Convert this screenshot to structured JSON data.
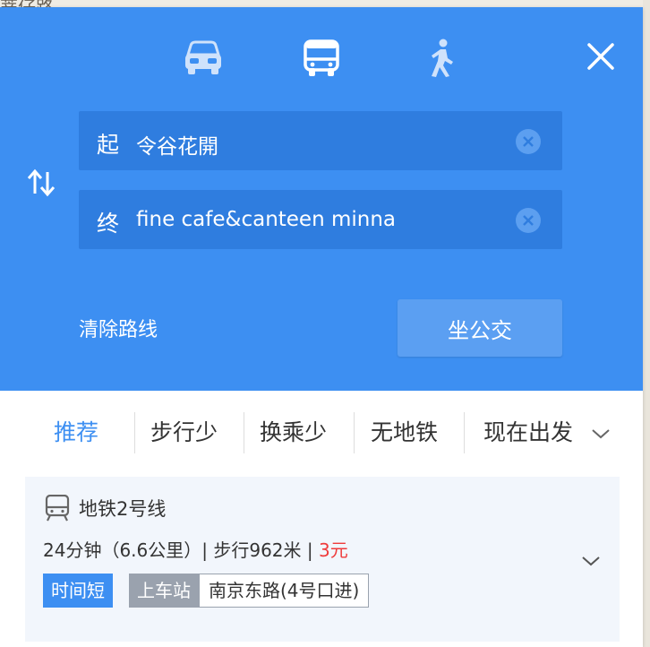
{
  "map": {
    "label": "蒂仔路"
  },
  "transport_modes": [
    {
      "name": "drive",
      "icon": "car-icon",
      "active": false
    },
    {
      "name": "bus",
      "icon": "bus-icon",
      "active": true
    },
    {
      "name": "walk",
      "icon": "walk-icon",
      "active": false
    }
  ],
  "route_input": {
    "start_tag": "起",
    "start_value": "令谷花開",
    "end_tag": "终",
    "end_value": "fine cafe&canteen minna"
  },
  "actions": {
    "clear_route": "清除路线",
    "go_button": "坐公交"
  },
  "tabs": [
    {
      "label": "推荐",
      "active": true
    },
    {
      "label": "步行少",
      "active": false
    },
    {
      "label": "换乘少",
      "active": false
    },
    {
      "label": "无地铁",
      "active": false
    }
  ],
  "depart_time": "现在出发",
  "route": {
    "line_name": "地铁2号线",
    "summary": "24分钟（6.6公里）| 步行962米 | ",
    "price": "3元",
    "badge": "时间短",
    "board_label": "上车站",
    "board_station": "南京东路(4号口进)"
  },
  "colors": {
    "header_bg": "#3d8ff2",
    "accent": "#3d8ff2",
    "price": "#ef3b3b"
  }
}
